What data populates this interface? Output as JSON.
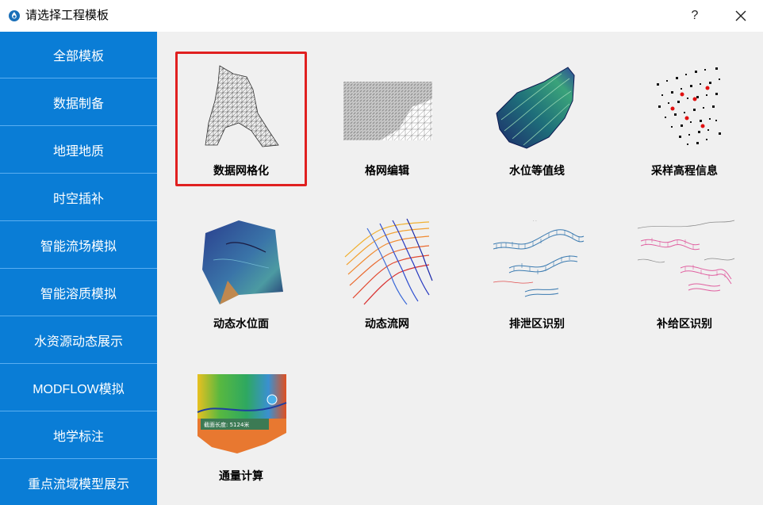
{
  "window": {
    "title": "请选择工程模板",
    "help_label": "?"
  },
  "sidebar": {
    "items": [
      {
        "label": "全部模板"
      },
      {
        "label": "数据制备"
      },
      {
        "label": "地理地质"
      },
      {
        "label": "时空插补"
      },
      {
        "label": "智能流场模拟"
      },
      {
        "label": "智能溶质模拟"
      },
      {
        "label": "水资源动态展示"
      },
      {
        "label": "MODFLOW模拟"
      },
      {
        "label": "地学标注"
      },
      {
        "label": "重点流域模型展示"
      }
    ]
  },
  "templates": [
    {
      "label": "数据网格化",
      "selected": true,
      "icon": "mesh-triangulation-icon"
    },
    {
      "label": "格网编辑",
      "selected": false,
      "icon": "grid-edit-icon"
    },
    {
      "label": "水位等值线",
      "selected": false,
      "icon": "water-level-contour-icon"
    },
    {
      "label": "采样高程信息",
      "selected": false,
      "icon": "sampling-points-icon"
    },
    {
      "label": "动态水位面",
      "selected": false,
      "icon": "dynamic-water-surface-icon"
    },
    {
      "label": "动态流网",
      "selected": false,
      "icon": "flow-net-icon"
    },
    {
      "label": "排泄区识别",
      "selected": false,
      "icon": "discharge-zone-icon"
    },
    {
      "label": "补给区识别",
      "selected": false,
      "icon": "recharge-zone-icon"
    },
    {
      "label": "通量计算",
      "selected": false,
      "icon": "flux-calc-icon",
      "overlay_text": "截面长度:   5124米"
    }
  ],
  "colors": {
    "sidebar_bg": "#0a7dd6",
    "selection_border": "#e02020",
    "content_bg": "#f0f0f0"
  }
}
